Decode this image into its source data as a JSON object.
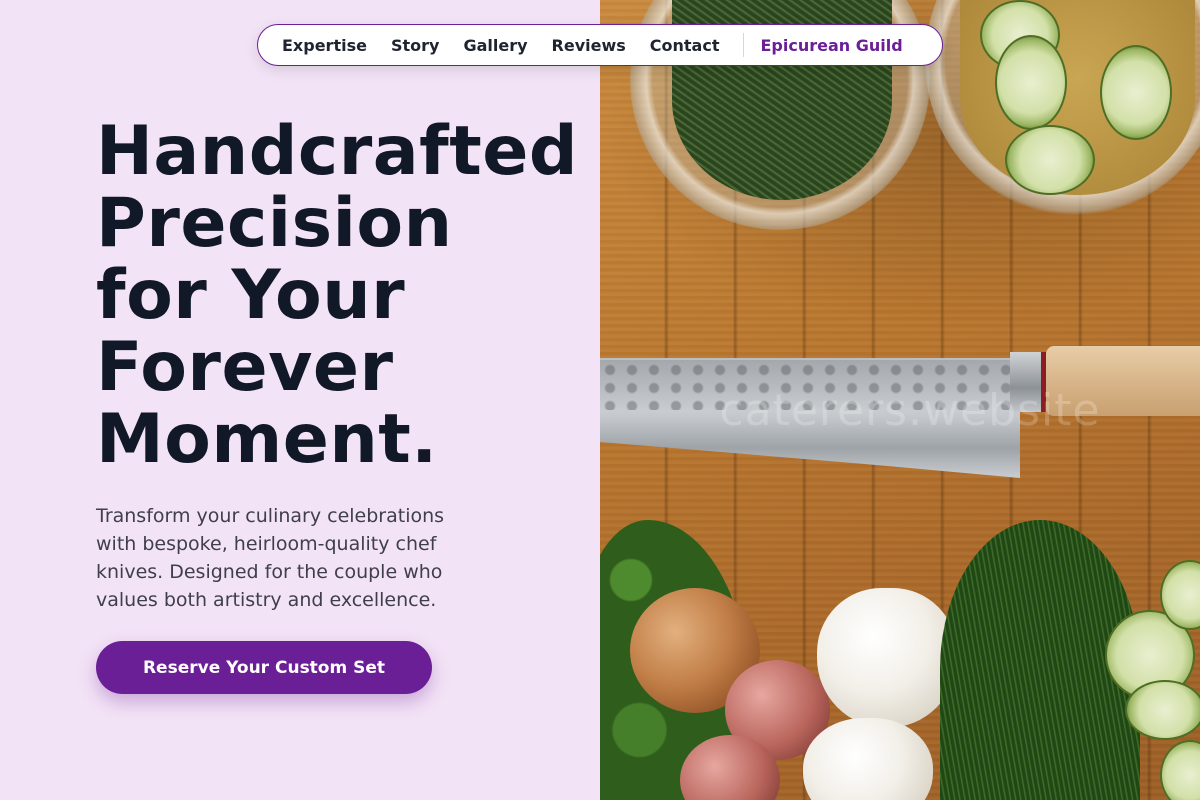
{
  "nav": {
    "items": [
      "Expertise",
      "Story",
      "Gallery",
      "Reviews",
      "Contact"
    ],
    "brand": "Epicurean Guild"
  },
  "hero": {
    "headline_lines": [
      "Handcrafted",
      "Precision",
      "for Your",
      "Forever",
      "Moment."
    ],
    "subcopy": "Transform your culinary celebrations with bespoke, heirloom-quality chef knives. Designed for the couple who values both artistry and excellence.",
    "cta_label": "Reserve Your Custom Set"
  },
  "photo": {
    "watermark": "caterers.website"
  },
  "colors": {
    "accent": "#6b1f97",
    "background": "#f3e3f6",
    "headline": "#111827"
  }
}
